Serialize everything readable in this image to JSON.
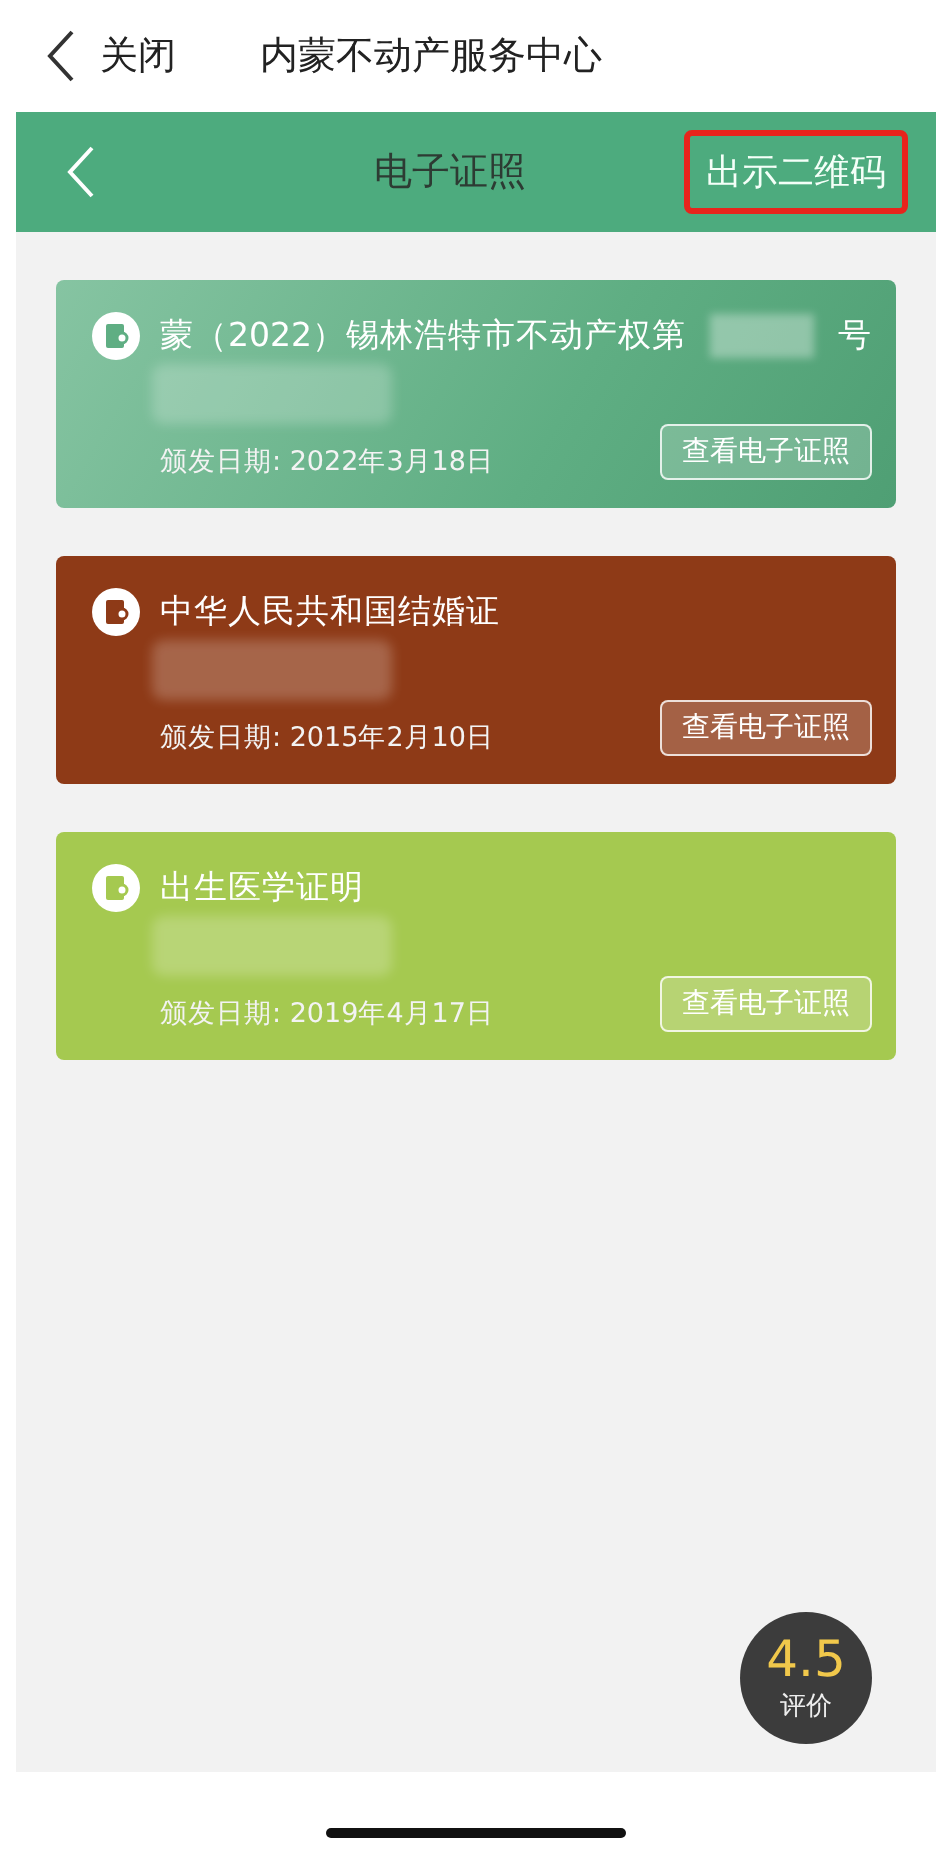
{
  "top_bar": {
    "close_label": "关闭",
    "title": "内蒙不动产服务中心"
  },
  "header": {
    "title": "电子证照",
    "qr_button": {
      "label": "出示二维码",
      "highlighted": true
    }
  },
  "cards": [
    {
      "title": "蒙（2022）锡林浩特市不动产权第",
      "title_redacted": true,
      "title_end": "号",
      "color": "#5fae83",
      "redacted": true,
      "date": "颁发日期: 2022年3月18日",
      "button": "查看电子证照"
    },
    {
      "title": "中华人民共和国结婚证",
      "title_redacted": false,
      "color": "#8e3a17",
      "redacted": true,
      "date": "颁发日期: 2015年2月10日",
      "button": "查看电子证照"
    },
    {
      "title": "出生医学证明",
      "title_redacted": false,
      "color": "#a5c950",
      "redacted": true,
      "date": "颁发日期: 2019年4月17日",
      "button": "查看电子证照"
    }
  ],
  "rating": {
    "score": "4.5",
    "label": "评价"
  }
}
